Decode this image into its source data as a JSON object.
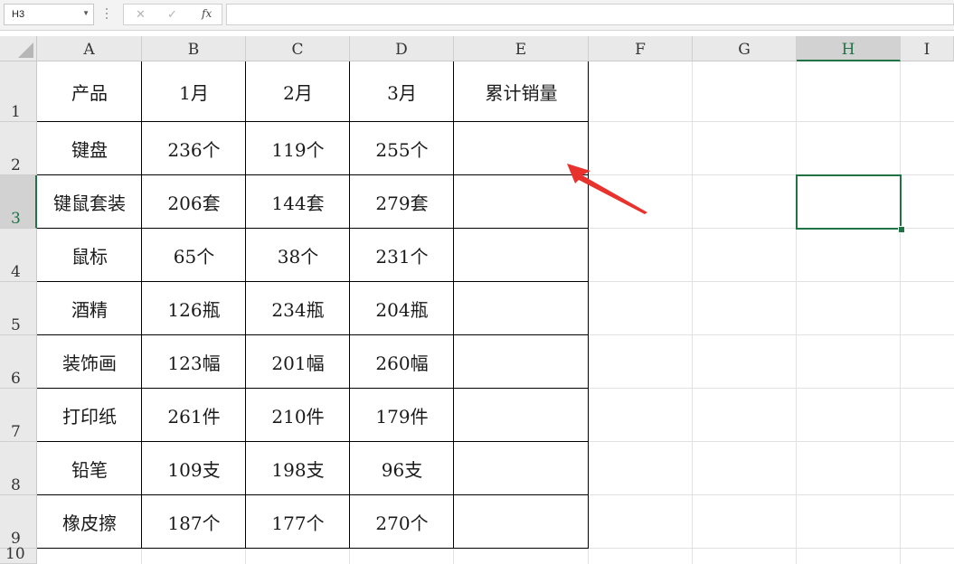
{
  "name_box": "H3",
  "formula_bar": {
    "cancel_icon": "✕",
    "enter_icon": "✓",
    "function_label": "fx",
    "formula": ""
  },
  "columns": [
    "A",
    "B",
    "C",
    "D",
    "E",
    "F",
    "G",
    "H",
    "I"
  ],
  "rows": [
    "1",
    "2",
    "3",
    "4",
    "5",
    "6",
    "7",
    "8",
    "9",
    "10"
  ],
  "selected_cell": "H3",
  "table": {
    "header": [
      "产品",
      "1月",
      "2月",
      "3月",
      "累计销量"
    ],
    "rows": [
      [
        "键盘",
        "236个",
        "119个",
        "255个",
        ""
      ],
      [
        "键鼠套装",
        "206套",
        "144套",
        "279套",
        ""
      ],
      [
        "鼠标",
        "65个",
        "38个",
        "231个",
        ""
      ],
      [
        "酒精",
        "126瓶",
        "234瓶",
        "204瓶",
        ""
      ],
      [
        "装饰画",
        "123幅",
        "201幅",
        "260幅",
        ""
      ],
      [
        "打印纸",
        "261件",
        "210件",
        "179件",
        ""
      ],
      [
        "铅笔",
        "109支",
        "198支",
        "96支",
        ""
      ],
      [
        "橡皮擦",
        "187个",
        "177个",
        "270个",
        ""
      ]
    ]
  },
  "colors": {
    "accent": "#217346",
    "annotation_arrow": "#e8322d",
    "header_bg": "#e9e9e9",
    "selected_header_bg": "#d2d2d2"
  },
  "icons": {
    "cancel": "close-icon",
    "enter": "check-icon",
    "function": "function-icon",
    "dropdown": "chevron-down-icon",
    "annotation": "red-pointer-arrow-icon"
  }
}
